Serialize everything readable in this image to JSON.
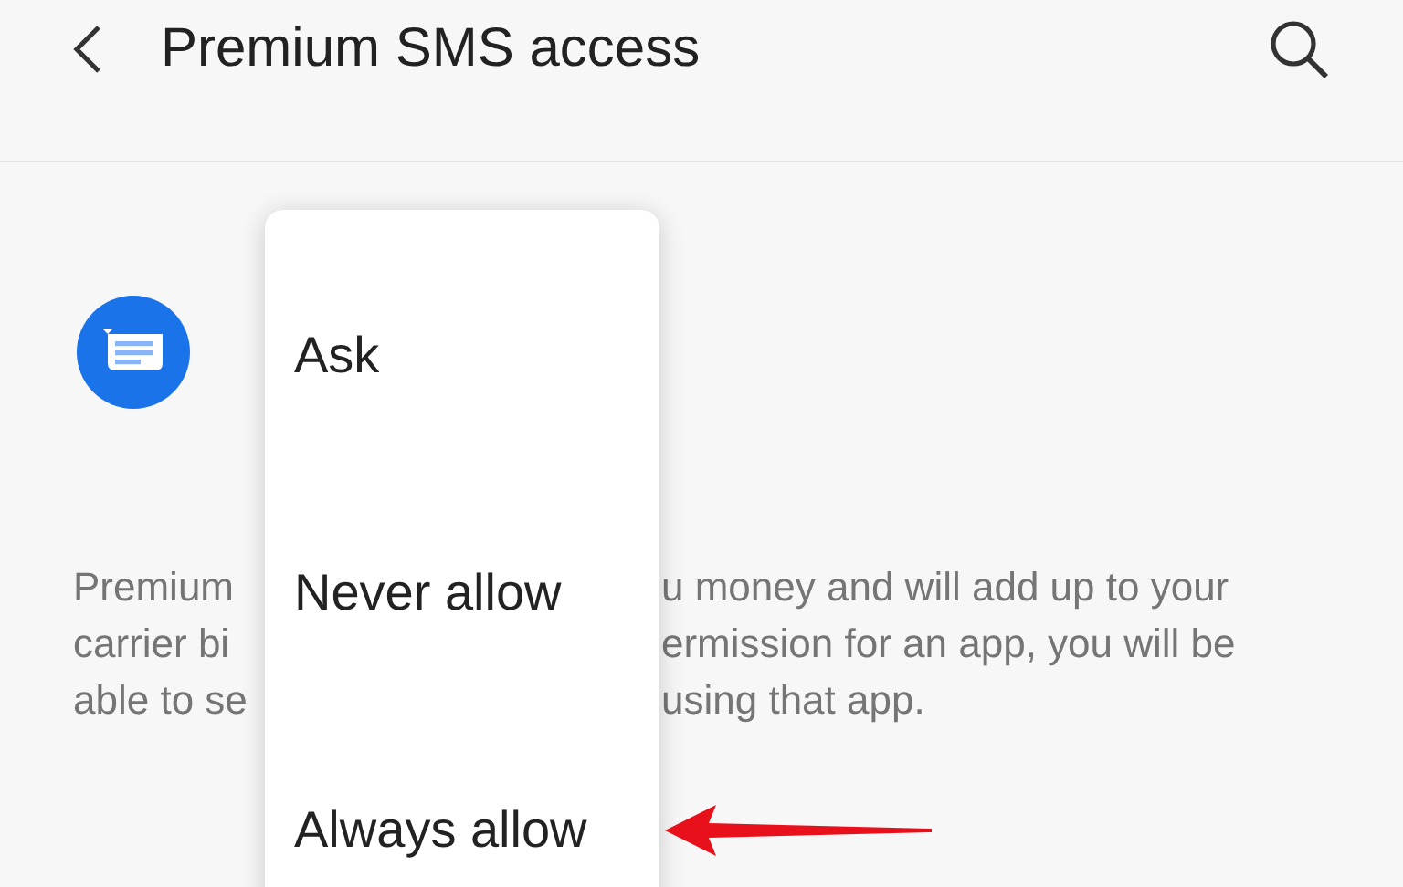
{
  "header": {
    "title": "Premium SMS access"
  },
  "description_lines": [
    {
      "left": "Premium",
      "right": "u money and will add up to your"
    },
    {
      "left": "carrier bi",
      "right": "ermission for an app, you will be"
    },
    {
      "left": "able to se",
      "right": "using that app."
    }
  ],
  "menu": {
    "items": [
      {
        "label": "Ask"
      },
      {
        "label": "Never allow"
      },
      {
        "label": "Always allow"
      }
    ]
  },
  "annotation": {
    "kind": "arrow"
  }
}
